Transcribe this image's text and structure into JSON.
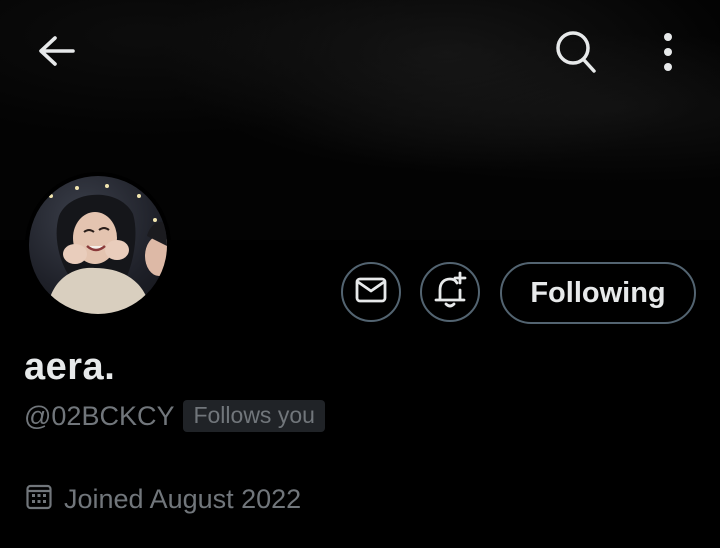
{
  "header": {
    "back_icon": "arrow-left-icon",
    "search_icon": "search-icon",
    "more_icon": "more-vertical-icon"
  },
  "profile": {
    "display_name": "aera.",
    "handle": "@02BCKCY",
    "follows_you": "Follows you",
    "joined": "Joined August 2022",
    "joined_icon": "calendar-icon"
  },
  "actions": {
    "message_icon": "mail-icon",
    "notify_icon": "bell-plus-icon",
    "following_label": "Following"
  },
  "colors": {
    "background": "#000000",
    "text_primary": "#e7e9ea",
    "text_secondary": "#71767b",
    "button_border": "#536471",
    "badge_bg": "#202327"
  }
}
